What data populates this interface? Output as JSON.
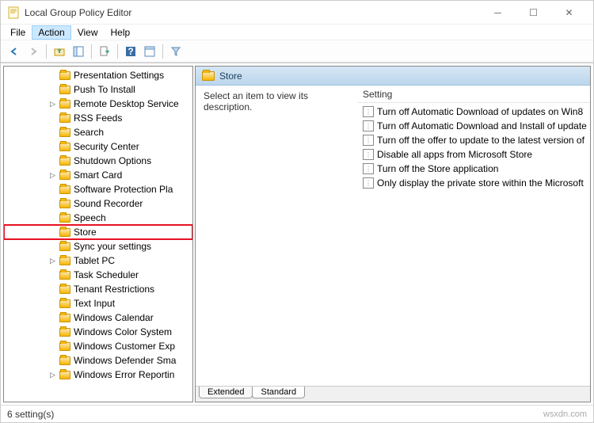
{
  "window": {
    "title": "Local Group Policy Editor"
  },
  "menu": {
    "file": "File",
    "action": "Action",
    "view": "View",
    "help": "Help"
  },
  "right_pane": {
    "heading": "Store",
    "description_prompt": "Select an item to view its description.",
    "column_header": "Setting",
    "settings": [
      "Turn off Automatic Download of updates on Win8",
      "Turn off Automatic Download and Install of update",
      "Turn off the offer to update to the latest version of",
      "Disable all apps from Microsoft Store",
      "Turn off the Store application",
      "Only display the private store within the Microsoft"
    ],
    "tabs": {
      "extended": "Extended",
      "standard": "Standard"
    }
  },
  "tree": {
    "items": [
      {
        "label": "Presentation Settings",
        "expandable": false
      },
      {
        "label": "Push To Install",
        "expandable": false
      },
      {
        "label": "Remote Desktop Service",
        "expandable": true
      },
      {
        "label": "RSS Feeds",
        "expandable": false
      },
      {
        "label": "Search",
        "expandable": false
      },
      {
        "label": "Security Center",
        "expandable": false
      },
      {
        "label": "Shutdown Options",
        "expandable": false
      },
      {
        "label": "Smart Card",
        "expandable": true
      },
      {
        "label": "Software Protection Pla",
        "expandable": false
      },
      {
        "label": "Sound Recorder",
        "expandable": false
      },
      {
        "label": "Speech",
        "expandable": false
      },
      {
        "label": "Store",
        "expandable": false,
        "highlight": true
      },
      {
        "label": "Sync your settings",
        "expandable": false
      },
      {
        "label": "Tablet PC",
        "expandable": true
      },
      {
        "label": "Task Scheduler",
        "expandable": false
      },
      {
        "label": "Tenant Restrictions",
        "expandable": false
      },
      {
        "label": "Text Input",
        "expandable": false
      },
      {
        "label": "Windows Calendar",
        "expandable": false
      },
      {
        "label": "Windows Color System",
        "expandable": false
      },
      {
        "label": "Windows Customer Exp",
        "expandable": false
      },
      {
        "label": "Windows Defender Sma",
        "expandable": false
      },
      {
        "label": "Windows Error Reportin",
        "expandable": true
      }
    ]
  },
  "status": {
    "text": "6 setting(s)",
    "watermark": "wsxdn.com"
  }
}
